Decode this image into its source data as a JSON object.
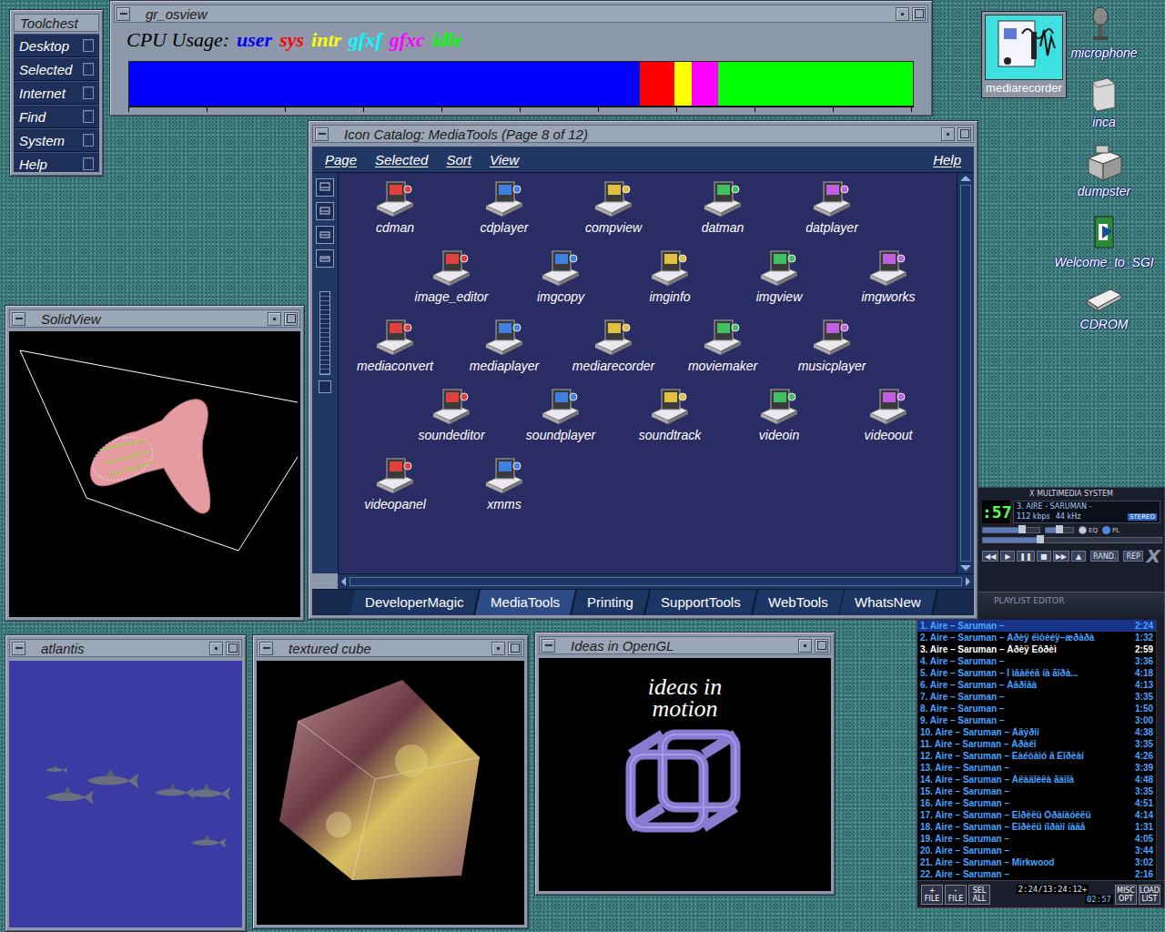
{
  "toolchest": {
    "title": "Toolchest",
    "items": [
      "Desktop",
      "Selected",
      "Internet",
      "Find",
      "System",
      "Help"
    ]
  },
  "osview": {
    "title": "gr_osview",
    "label": "CPU Usage:",
    "series": [
      {
        "name": "user",
        "color": "#0000ff",
        "level": 0.652
      },
      {
        "name": "sys",
        "color": "#ff0000",
        "level": 0.044
      },
      {
        "name": "intr",
        "color": "#ffff00",
        "level": 0.022
      },
      {
        "name": "gfxf",
        "color": "#00ffff",
        "level": 0
      },
      {
        "name": "gfxc",
        "color": "#ff00ff",
        "level": 0.034
      },
      {
        "name": "idle",
        "color": "#00ff00",
        "level": 0.248
      }
    ]
  },
  "desktop_icons": [
    {
      "label": "mediarecorder",
      "selected": true
    },
    {
      "label": "microphone",
      "selected": false
    },
    {
      "label": "inca",
      "selected": false
    },
    {
      "label": "dumpster",
      "selected": false
    },
    {
      "label": "Welcome_to_SGI",
      "selected": false
    },
    {
      "label": "CDROM",
      "selected": false
    }
  ],
  "catalog": {
    "title": "Icon Catalog: MediaTools (Page 8 of 12)",
    "menu": [
      "Page",
      "Selected",
      "Sort",
      "View"
    ],
    "help": "Help",
    "icons": [
      "cdman",
      "cdplayer",
      "compview",
      "datman",
      "datplayer",
      "image_editor",
      "imgcopy",
      "imginfo",
      "imgview",
      "imgworks",
      "mediaconvert",
      "mediaplayer",
      "mediarecorder",
      "moviemaker",
      "musicplayer",
      "soundeditor",
      "soundplayer",
      "soundtrack",
      "videoin",
      "videoout",
      "videopanel",
      "xmms"
    ],
    "tabs": [
      {
        "label": "DeveloperMagic",
        "selected": false
      },
      {
        "label": "MediaTools",
        "selected": true
      },
      {
        "label": "Printing",
        "selected": false
      },
      {
        "label": "SupportTools",
        "selected": false
      },
      {
        "label": "WebTools",
        "selected": false
      },
      {
        "label": "WhatsNew",
        "selected": false
      }
    ]
  },
  "gl_windows": {
    "solidview": {
      "title": "SolidView"
    },
    "atlantis": {
      "title": "atlantis"
    },
    "cube": {
      "title": "textured cube"
    },
    "opengl": {
      "title": "Ideas in OpenGL",
      "caption": "ideas in motion"
    }
  },
  "xmms": {
    "header": "X MULTIMEDIA SYSTEM",
    "time": ":57",
    "song": "3. AIRE - SARUMAN -",
    "bitrate": "112 kbps",
    "samplerate": "44 kHz",
    "stereo": {
      "label": "STEREO",
      "on": true
    },
    "eq": {
      "label": "EQ",
      "on": false
    },
    "pl": {
      "label": "PL",
      "on": true
    },
    "volume": {
      "level": 0.7
    },
    "balance": {
      "level": 0.5
    },
    "seek": {
      "level": 0.32
    },
    "controls": [
      "◀◀",
      "▶",
      "❚❚",
      "■",
      "▶▶",
      "▲"
    ],
    "shuffle": {
      "label": "RAND.",
      "on": false
    },
    "repeat": {
      "label": "REP",
      "on": false
    },
    "logo": "X"
  },
  "playlist": {
    "title": "PLAYLIST EDITOR",
    "rows": [
      {
        "title": "1. Aire – Saruman –",
        "time": "2:24",
        "current": false,
        "selected": true
      },
      {
        "title": "2. Aire – Saruman – Àðèÿ ëìôèéÿ–æðàðà",
        "time": "1:32",
        "current": false,
        "selected": false
      },
      {
        "title": "3. Aire – Saruman – Àðèÿ Ëôðèì",
        "time": "2:59",
        "current": true,
        "selected": false
      },
      {
        "title": "4. Aire – Saruman –",
        "time": "3:36",
        "current": false,
        "selected": false
      },
      {
        "title": "5. Aire – Saruman – Î ìâàëéâ íà ãîðà...",
        "time": "4:18",
        "current": false,
        "selected": false
      },
      {
        "title": "6. Aire – Saruman – Àâðîâà",
        "time": "4:13",
        "current": false,
        "selected": false
      },
      {
        "title": "7. Aire – Saruman –",
        "time": "3:35",
        "current": false,
        "selected": false
      },
      {
        "title": "8. Aire – Saruman –",
        "time": "1:50",
        "current": false,
        "selected": false
      },
      {
        "title": "9. Aire – Saruman –",
        "time": "3:00",
        "current": false,
        "selected": false
      },
      {
        "title": "10. Aire – Saruman – Àäýðîí",
        "time": "4:38",
        "current": false,
        "selected": false
      },
      {
        "title": "11. Aire – Saruman – Àðàéî",
        "time": "3:35",
        "current": false,
        "selected": false
      },
      {
        "title": "12. Aire – Saruman – Ëàéòàìó â Ëîðèàí",
        "time": "4:26",
        "current": false,
        "selected": false
      },
      {
        "title": "13. Aire – Saruman –",
        "time": "3:39",
        "current": false,
        "selected": false
      },
      {
        "title": "14. Aire – Saruman – Àëàäîèëà ãàìîà",
        "time": "4:48",
        "current": false,
        "selected": false
      },
      {
        "title": "15. Aire – Saruman –",
        "time": "3:35",
        "current": false,
        "selected": false
      },
      {
        "title": "16. Aire – Saruman –",
        "time": "4:51",
        "current": false,
        "selected": false
      },
      {
        "title": "17. Aire – Saruman – Ëîðèëü Òðàíäóèëü",
        "time": "4:14",
        "current": false,
        "selected": false
      },
      {
        "title": "18. Aire – Saruman – Ëîðèëü íîðàìî íàäå",
        "time": "1:31",
        "current": false,
        "selected": false
      },
      {
        "title": "19. Aire – Saruman –",
        "time": "4:05",
        "current": false,
        "selected": false
      },
      {
        "title": "20. Aire – Saruman –",
        "time": "3:44",
        "current": false,
        "selected": false
      },
      {
        "title": "21. Aire – Saruman – Mirkwood",
        "time": "3:02",
        "current": false,
        "selected": false
      },
      {
        "title": "22. Aire – Saruman –",
        "time": "2:16",
        "current": false,
        "selected": false
      }
    ],
    "buttons": [
      "+ FILE",
      "- FILE",
      "SEL ALL",
      "MISC OPT",
      "LOAD LIST"
    ],
    "total": "2:24/13:24:12+",
    "clock": "02:57"
  }
}
